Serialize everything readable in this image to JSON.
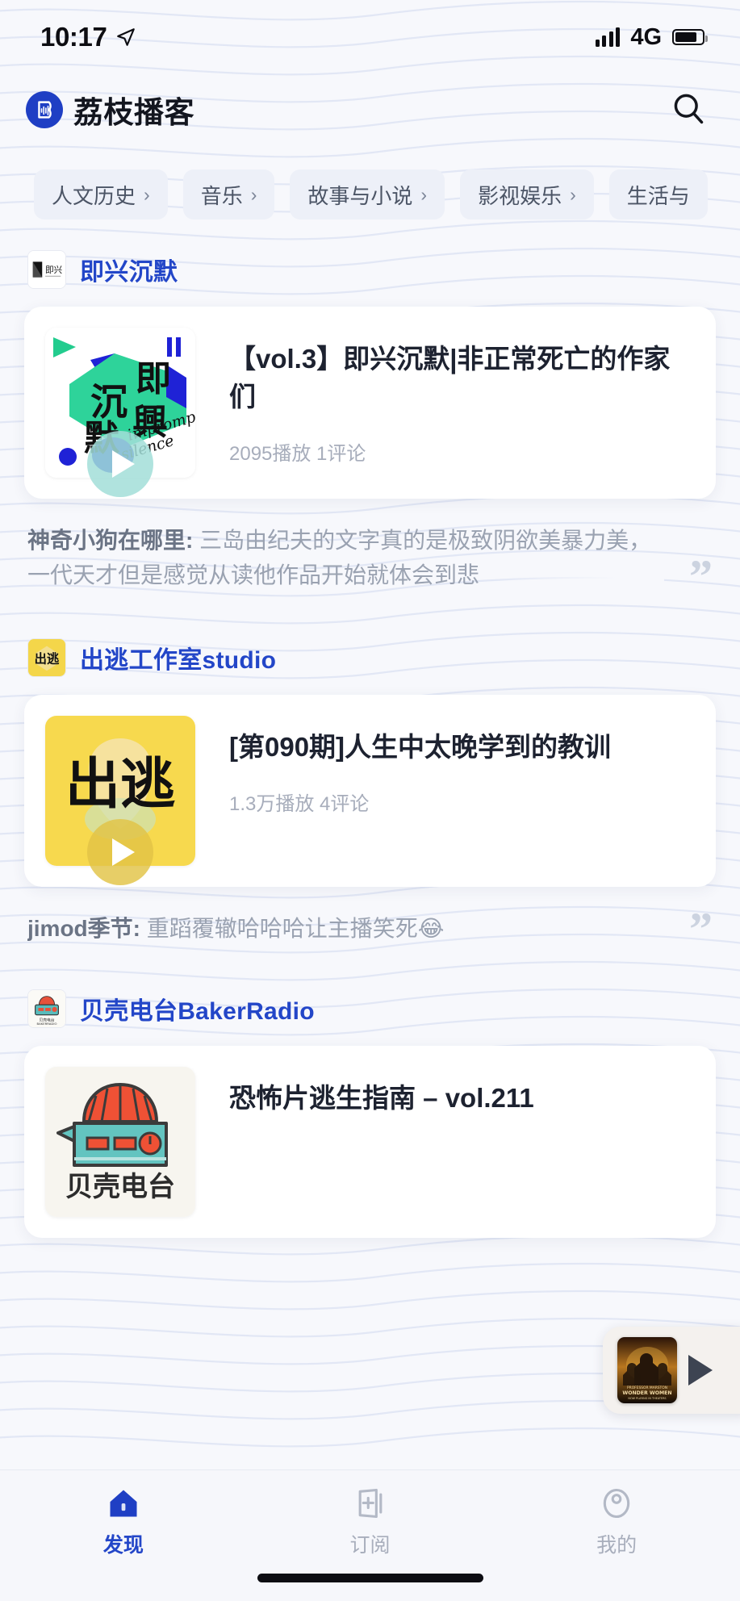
{
  "status_bar": {
    "time": "10:17",
    "location_icon": "location-arrow-icon",
    "network": "4G",
    "signal_icon": "signal-bars-icon",
    "battery_icon": "battery-icon"
  },
  "header": {
    "app_name": "荔枝播客",
    "logo_icon": "lizhi-podcast-logo-icon",
    "search_icon": "search-icon"
  },
  "categories": [
    {
      "label": "人文历史",
      "carat": "›"
    },
    {
      "label": "音乐",
      "carat": "›"
    },
    {
      "label": "故事与小说",
      "carat": "›"
    },
    {
      "label": "影视娱乐",
      "carat": "›"
    },
    {
      "label": "生活与",
      "carat": ""
    }
  ],
  "sections": [
    {
      "podcast_name": "即兴沉默",
      "logo_icon": "jixing-chenmo-logo-icon",
      "episode": {
        "title": "【vol.3】即兴沉默|非正常死亡的作家们",
        "meta": "2095播放  1评论",
        "cover_icon": "impromptu-silence-cover",
        "play_icon": "play-icon"
      },
      "comment": {
        "author": "神奇小狗在哪里:",
        "text": " 三岛由纪夫的文字真的是极致阴欲美暴力美，一代天才但是感觉从读他作品开始就体会到悲",
        "quote_icon": "quote-mark-icon"
      }
    },
    {
      "podcast_name": "出逃工作室studio",
      "logo_icon": "chutao-studio-logo-icon",
      "episode": {
        "title": "[第090期]人生中太晚学到的教训",
        "meta": "1.3万播放  4评论",
        "cover_icon": "chutao-cover",
        "play_icon": "play-icon"
      },
      "comment": {
        "author": "jimod季节:",
        "text": " 重蹈覆辙哈哈哈让主播笑死😂",
        "quote_icon": "quote-mark-icon"
      }
    },
    {
      "podcast_name": "贝壳电台BakerRadio",
      "logo_icon": "baker-radio-logo-icon",
      "episode": {
        "title": "恐怖片逃生指南 – vol.211",
        "meta": "",
        "cover_icon": "baker-radio-cover",
        "play_icon": "play-icon"
      },
      "comment": null
    }
  ],
  "mini_player": {
    "artwork_icon": "now-playing-artwork",
    "play_icon": "play-icon"
  },
  "tabs": [
    {
      "label": "发现",
      "icon": "home-icon",
      "active": true
    },
    {
      "label": "订阅",
      "icon": "subscribe-icon",
      "active": false
    },
    {
      "label": "我的",
      "icon": "profile-icon",
      "active": false
    }
  ],
  "colors": {
    "background": "#f7f8fc",
    "brand_blue": "#2346c8",
    "card": "#ffffff",
    "muted_text": "#9aa2b1"
  }
}
